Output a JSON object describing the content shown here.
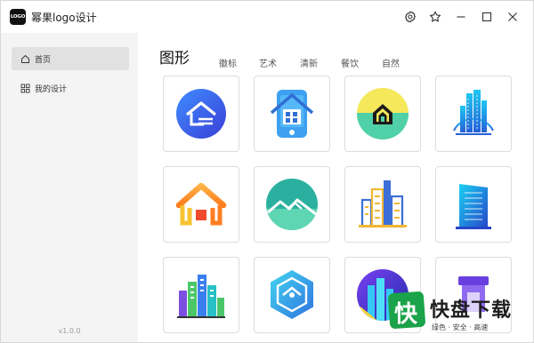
{
  "app": {
    "logo_text": "LOGO",
    "title": "幂果logo设计"
  },
  "title_bar": {
    "icons": [
      "settings-icon",
      "star-icon",
      "minimize-icon",
      "maximize-icon",
      "close-icon"
    ]
  },
  "sidebar": {
    "items": [
      {
        "label": "首页",
        "icon": "home-icon",
        "active": true
      },
      {
        "label": "我的设计",
        "icon": "grid-icon",
        "active": false
      }
    ],
    "version": "v1.0.0"
  },
  "categories": {
    "active": "图形",
    "items": [
      "图形",
      "徽标",
      "艺术",
      "清新",
      "餐饮",
      "自然"
    ],
    "accent_color": "#e8402d"
  },
  "templates": [
    {
      "icon": "blue-circle-house-icon"
    },
    {
      "icon": "phone-house-icon"
    },
    {
      "icon": "yellow-green-house-icon"
    },
    {
      "icon": "blue-skyscraper-icon"
    },
    {
      "icon": "orange-roof-house-icon"
    },
    {
      "icon": "teal-mountain-house-icon"
    },
    {
      "icon": "city-buildings-icon"
    },
    {
      "icon": "blue-tower-icon"
    },
    {
      "icon": "colorful-city-icon"
    },
    {
      "icon": "hexagon-house-icon"
    },
    {
      "icon": "purple-city-circle-icon"
    },
    {
      "icon": "purple-shop-icon"
    }
  ],
  "watermark": {
    "logo_char": "快",
    "brand": "快盘下载",
    "tagline": "绿色 · 安全 · 高速"
  }
}
